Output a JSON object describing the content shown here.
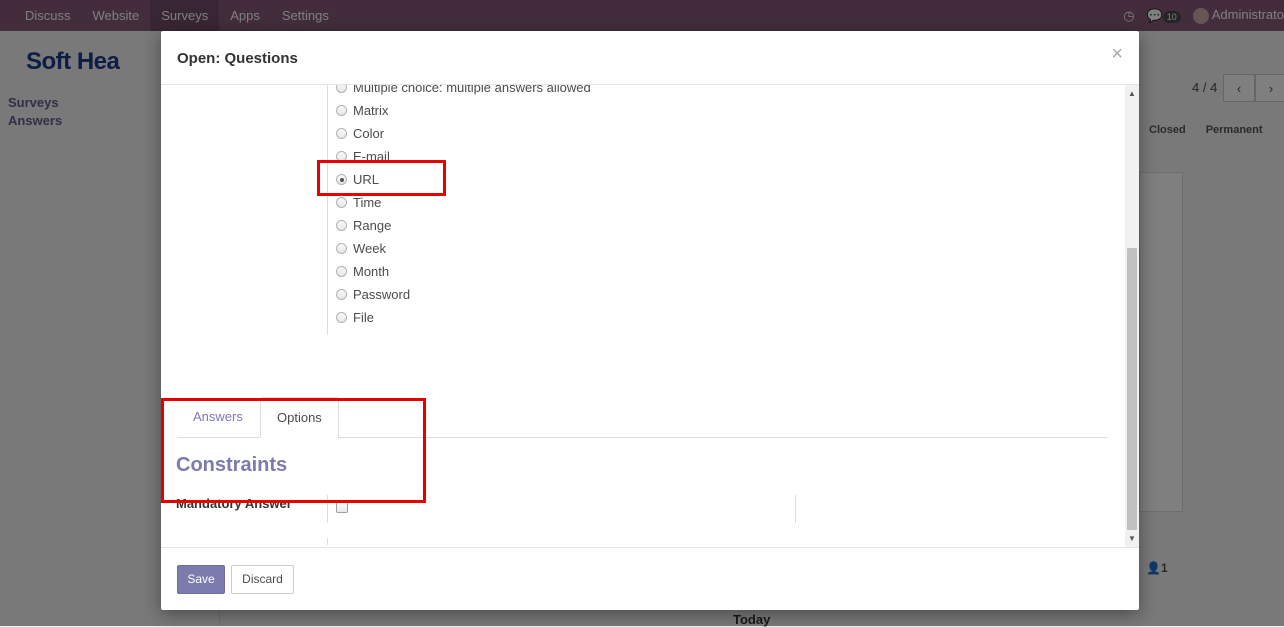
{
  "topbar": {
    "menu": [
      "Discuss",
      "Website",
      "Surveys",
      "Apps",
      "Settings"
    ],
    "active": "Surveys",
    "user": "Administrato",
    "message_count": "10"
  },
  "background": {
    "logo_text": "Soft Hea",
    "sidebar": [
      "Surveys",
      "Answers"
    ],
    "pager": "4 / 4",
    "status_closed": "Closed",
    "status_permanent": "Permanent",
    "attendee_count": "1",
    "today_label": "Today"
  },
  "modal": {
    "title": "Open: Questions",
    "close_glyph": "×",
    "question_types": [
      {
        "label": "Multiple choice: multiple answers allowed",
        "checked": false
      },
      {
        "label": "Matrix",
        "checked": false
      },
      {
        "label": "Color",
        "checked": false
      },
      {
        "label": "E-mail",
        "checked": false
      },
      {
        "label": "URL",
        "checked": true
      },
      {
        "label": "Time",
        "checked": false
      },
      {
        "label": "Range",
        "checked": false
      },
      {
        "label": "Week",
        "checked": false
      },
      {
        "label": "Month",
        "checked": false
      },
      {
        "label": "Password",
        "checked": false
      },
      {
        "label": "File",
        "checked": false
      }
    ],
    "tabs": {
      "answers": "Answers",
      "options": "Options",
      "active": "Options"
    },
    "constraints_title": "Constraints",
    "mandatory_label": "Mandatory Answer",
    "mandatory_checked": false,
    "save_label": "Save",
    "discard_label": "Discard"
  },
  "colors": {
    "accent": "#7c7bad",
    "topbar": "#875a7b",
    "highlight": "#e60000"
  }
}
